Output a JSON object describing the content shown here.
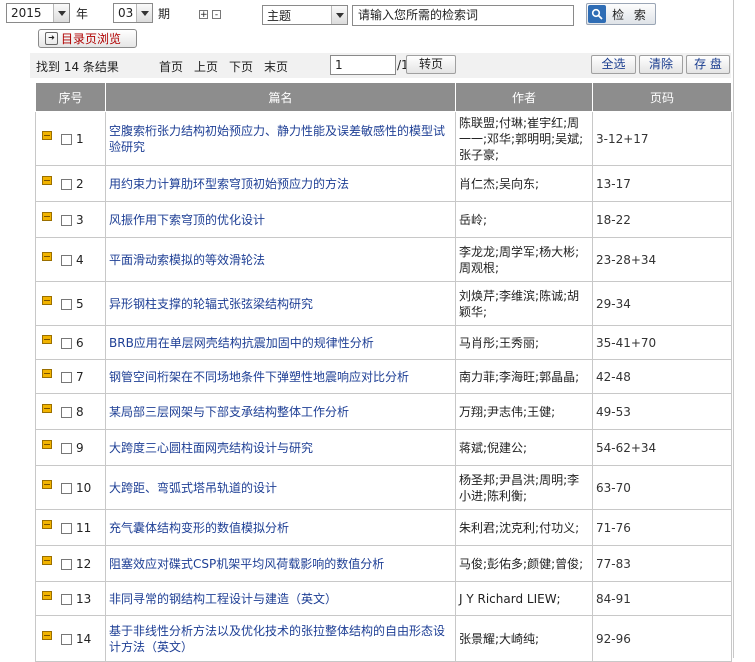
{
  "filters": {
    "year": "2015",
    "year_label": "年",
    "issue": "03",
    "issue_label": "期",
    "expand_symbol": "+",
    "collapse_symbol": "-",
    "field": "主题",
    "search_placeholder": "请输入您所需的检索词",
    "search_button": "检 索",
    "toc_button": "目录页浏览"
  },
  "toolbar": {
    "results_text": "找到 14 条结果",
    "first": "首页",
    "prev": "上页",
    "next": "下页",
    "last": "末页",
    "page_value": "1",
    "page_total": "/1",
    "goto": "转页",
    "select_all": "全选",
    "clear": "清除",
    "save": "存 盘"
  },
  "table": {
    "headers": {
      "index": "序号",
      "title": "篇名",
      "author": "作者",
      "pages": "页码"
    },
    "rows": [
      {
        "n": "1",
        "title": "空腹索桁张力结构初始预应力、静力性能及误差敏感性的模型试验研究",
        "author": "陈联盟;付琳;崔宇红;周一一;邓华;郭明明;吴斌;张子豪;",
        "pages": "3-12+17"
      },
      {
        "n": "2",
        "title": "用约束力计算肋环型索穹顶初始预应力的方法",
        "author": "肖仁杰;吴向东;",
        "pages": "13-17"
      },
      {
        "n": "3",
        "title": "风振作用下索穹顶的优化设计",
        "author": "岳岭;",
        "pages": "18-22"
      },
      {
        "n": "4",
        "title": "平面滑动索模拟的等效滑轮法",
        "author": "李龙龙;周学军;杨大彬;周观根;",
        "pages": "23-28+34"
      },
      {
        "n": "5",
        "title": "异形钢柱支撑的轮辐式张弦梁结构研究",
        "author": "刘焕芹;李维滨;陈诚;胡颖华;",
        "pages": "29-34"
      },
      {
        "n": "6",
        "title": "BRB应用在单层网壳结构抗震加固中的规律性分析",
        "author": "马肖彤;王秀丽;",
        "pages": "35-41+70"
      },
      {
        "n": "7",
        "title": "钢管空间桁架在不同场地条件下弹塑性地震响应对比分析",
        "author": "南力菲;李海旺;郭晶晶;",
        "pages": "42-48"
      },
      {
        "n": "8",
        "title": "某局部三层网架与下部支承结构整体工作分析",
        "author": "万翔;尹志伟;王健;",
        "pages": "49-53"
      },
      {
        "n": "9",
        "title": "大跨度三心圆柱面网壳结构设计与研究",
        "author": "蒋斌;倪建公;",
        "pages": "54-62+34"
      },
      {
        "n": "10",
        "title": "大跨距、弯弧式塔吊轨道的设计",
        "author": "杨圣邦;尹昌洪;周明;李小进;陈利衡;",
        "pages": "63-70"
      },
      {
        "n": "11",
        "title": "充气囊体结构变形的数值模拟分析",
        "author": "朱利君;沈克利;付功义;",
        "pages": "71-76"
      },
      {
        "n": "12",
        "title": "阻塞效应对碟式CSP机架平均风荷载影响的数值分析",
        "author": "马俊;彭佑多;颜健;曾俊;",
        "pages": "77-83"
      },
      {
        "n": "13",
        "title": "非同寻常的钢结构工程设计与建造（英文）",
        "author": "J Y Richard LIEW;",
        "pages": "84-91"
      },
      {
        "n": "14",
        "title": "基于非线性分析方法以及优化技术的张拉整体结构的自由形态设计方法（英文）",
        "author": "张景耀;大崎纯;",
        "pages": "92-96"
      }
    ]
  }
}
